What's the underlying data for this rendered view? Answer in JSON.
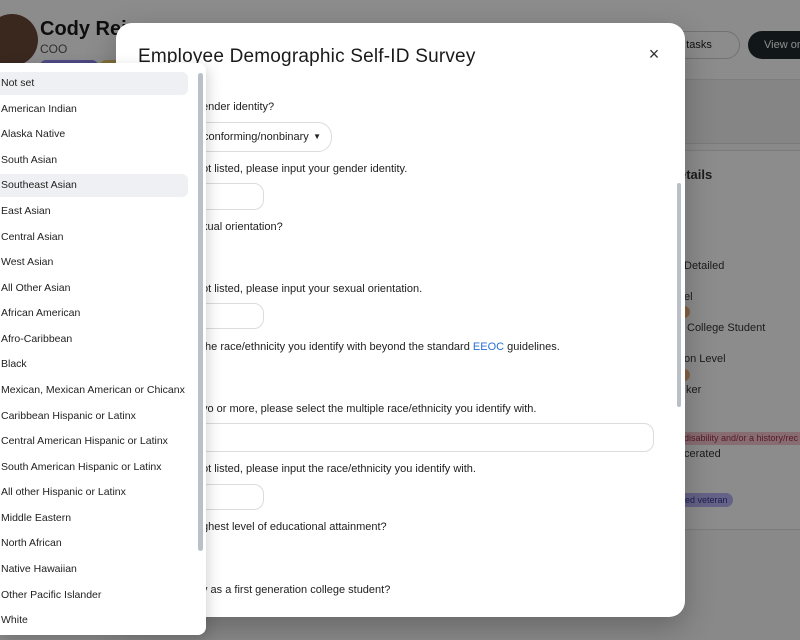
{
  "background": {
    "profile_name": "Cody Rein",
    "profile_role": "COO",
    "tasks_button": "e tasks",
    "view_button": "View on",
    "card_title": "etails",
    "card_lines": [
      "Detailed",
      "el",
      "College Student",
      "on Level",
      "ker",
      "cerated"
    ],
    "tag_disability": "disability and/or a history/rec",
    "tag_veteran": "ed veteran"
  },
  "modal": {
    "title": "Employee Demographic Self-ID Survey",
    "close_label": "×",
    "questions": [
      "ender identity?",
      "ot listed, please input your gender identity.",
      "xual orientation?",
      "ot listed, please input your sexual orientation.",
      "the race/ethnicity you identify with beyond the standard",
      "vo or more, please select the multiple race/ethnicity you identify with.",
      "ot listed, please input the race/ethnicity you identify with.",
      "ghest level of educational attainment?",
      "y as a first generation college student?"
    ],
    "eeoc_link": "EEOC",
    "guidelines_text": "guidelines.",
    "gender_select_value": "conforming/nonbinary",
    "caret": "▼"
  },
  "dropdown": {
    "selected": "Not set",
    "highlighted": "Southeast Asian",
    "options": [
      "Not set",
      "American Indian",
      "Alaska Native",
      "South Asian",
      "Southeast Asian",
      "East Asian",
      "Central Asian",
      "West Asian",
      "All Other Asian",
      "African American",
      "Afro-Caribbean",
      "Black",
      "Mexican, Mexican American or Chicanx",
      "Caribbean Hispanic or Latinx",
      "Central American Hispanic or Latinx",
      "South American Hispanic or Latinx",
      "All other Hispanic or Latinx",
      "Middle Eastern",
      "North African",
      "Native Hawaiian",
      "Other Pacific Islander",
      "White"
    ]
  },
  "colors": {
    "link": "#2a6fd6",
    "primary_button": "#1f2a2e",
    "highlight_row": "#eef0f3"
  }
}
